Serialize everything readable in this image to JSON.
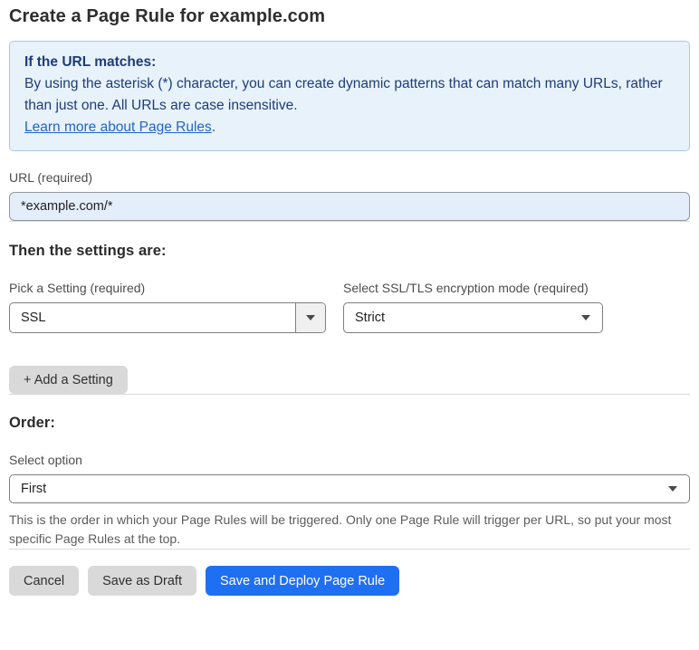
{
  "page": {
    "title": "Create a Page Rule for example.com"
  },
  "info_box": {
    "heading": "If the URL matches:",
    "body": "By using the asterisk (*) character, you can create dynamic patterns that can match many URLs, rather than just one. All URLs are case insensitive.",
    "link_label": "Learn more about Page Rules",
    "link_suffix": "."
  },
  "url_field": {
    "label": "URL (required)",
    "value": "*example.com/*"
  },
  "settings_section": {
    "heading": "Then the settings are:",
    "setting_select": {
      "label": "Pick a Setting (required)",
      "value": "SSL"
    },
    "mode_select": {
      "label": "Select SSL/TLS encryption mode (required)",
      "value": "Strict"
    },
    "add_setting_label": "+ Add a Setting"
  },
  "order_section": {
    "heading": "Order:",
    "select_label": "Select option",
    "select_value": "First",
    "help_text": "This is the order in which your Page Rules will be triggered. Only one Page Rule will trigger per URL, so put your most specific Page Rules at the top."
  },
  "footer": {
    "cancel_label": "Cancel",
    "save_draft_label": "Save as Draft",
    "save_deploy_label": "Save and Deploy Page Rule"
  },
  "colors": {
    "accent_blue": "#1f6ff2",
    "info_box_bg": "#e8f2fb",
    "info_box_border": "#abc9e4",
    "info_box_text": "#1d3c78",
    "link_blue": "#2166c9",
    "url_input_bg": "#e4eefb",
    "gray_button_bg": "#d9d9d9"
  }
}
